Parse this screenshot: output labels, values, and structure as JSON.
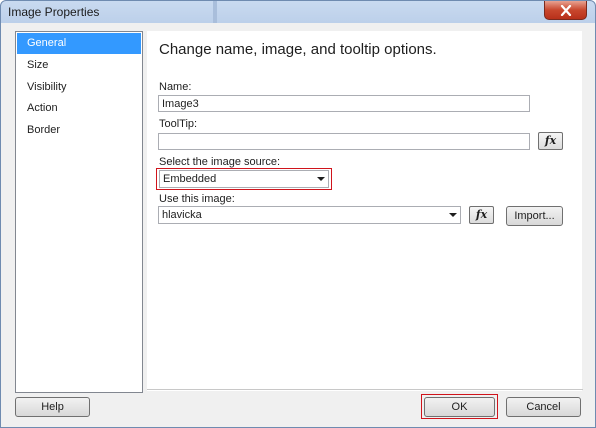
{
  "window": {
    "title": "Image Properties"
  },
  "nav": {
    "items": [
      "General",
      "Size",
      "Visibility",
      "Action",
      "Border"
    ],
    "selected": 0
  },
  "panel": {
    "header": "Change name, image, and tooltip options.",
    "name_label": "Name:",
    "name_value": "Image3",
    "tooltip_label": "ToolTip:",
    "tooltip_value": "",
    "source_label": "Select the image source:",
    "source_value": "Embedded",
    "use_image_label": "Use this image:",
    "use_image_value": "hlavicka",
    "fx_label": "fx",
    "import_label": "Import..."
  },
  "footer": {
    "help_label": "Help",
    "ok_label": "OK",
    "cancel_label": "Cancel"
  },
  "colors": {
    "selection": "#3399ff",
    "highlight": "#d0141c",
    "close": "#c8472d"
  },
  "icons": {
    "close": "close-icon",
    "expression": "fx-icon"
  }
}
